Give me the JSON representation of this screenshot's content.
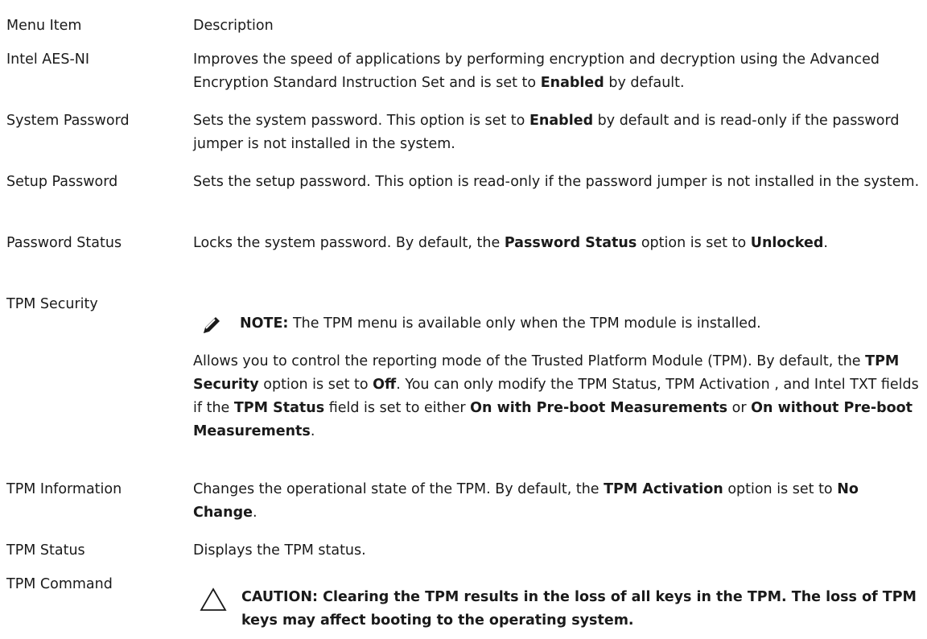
{
  "table": {
    "headers": {
      "item": "Menu Item",
      "description": "Description"
    },
    "rows": [
      {
        "term": "Intel AES-NI",
        "d1": "Improves the speed of applications by performing encryption and decryption using the Advanced Encryption Standard Instruction Set and is set to ",
        "b1": "Enabled",
        "d2": " by default."
      },
      {
        "term": "System Password",
        "d1": "Sets the system password. This option is set to ",
        "b1": "Enabled",
        "d2": " by default and is read-only if the password jumper is not installed in the system."
      },
      {
        "term": "Setup Password",
        "d1": "Sets the setup password. This option is read-only if the password jumper is not installed in the system."
      },
      {
        "term": "Password Status",
        "d1": "Locks the system password. By default, the ",
        "b1": "Password Status",
        "d2": " option is set to ",
        "b2": "Unlocked",
        "d3": "."
      },
      {
        "term": "TPM Security",
        "note_label": "NOTE:",
        "note_text": " The TPM menu is available only when the TPM module is installed.",
        "d1": "Allows you to control the reporting mode of the Trusted Platform Module (TPM). By default, the ",
        "b1": "TPM Security",
        "d2": " option is set to ",
        "b2": "Off",
        "d3": ". You can only modify the TPM Status, TPM Activation , and Intel TXT fields if the ",
        "b3": "TPM Status",
        "d4": " field is set to either ",
        "b4": "On with Pre-boot Measurements",
        "d5": " or ",
        "b5": "On without Pre-boot Measurements",
        "d6": "."
      },
      {
        "term": "TPM Information",
        "d1": "Changes the operational state of the TPM. By default, the ",
        "b1": "TPM Activation",
        "d2": " option is set to ",
        "b2": "No Change",
        "d3": "."
      },
      {
        "term": "TPM Status",
        "d1": "Displays the TPM status."
      },
      {
        "term": "TPM Command",
        "caution": "CAUTION: Clearing the TPM results in the loss of all keys in the TPM. The loss of TPM keys may affect booting to the operating system."
      }
    ]
  },
  "icons": {
    "note": "pencil-note-icon",
    "caution": "caution-triangle-icon"
  }
}
